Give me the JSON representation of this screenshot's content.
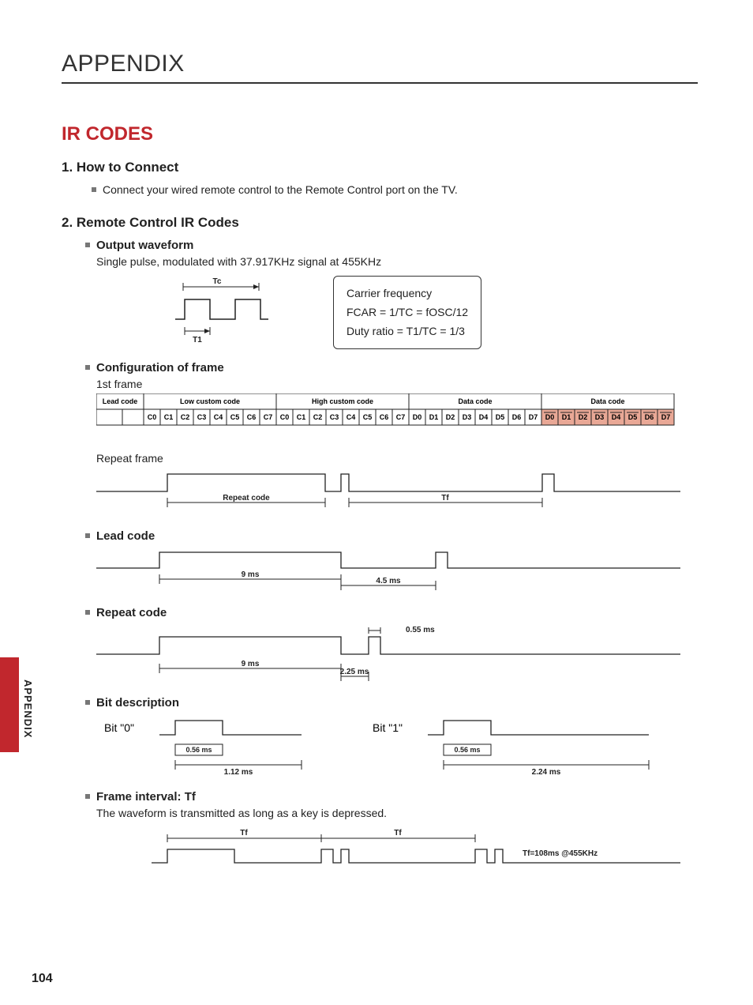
{
  "page_title": "APPENDIX",
  "section_title": "IR CODES",
  "s1": {
    "head": "1. How to Connect",
    "body": "Connect your wired remote control to the Remote Control port on the TV."
  },
  "s2": {
    "head": "2. Remote Control IR Codes",
    "output_waveform": {
      "label": "Output waveform",
      "desc": "Single pulse, modulated with 37.917KHz signal at 455KHz",
      "tc": "Tc",
      "t1": "T1",
      "box_line1": "Carrier frequency",
      "box_line2": "FCAR = 1/TC = fOSC/12",
      "box_line3": "Duty ratio = T1/TC = 1/3"
    },
    "config": {
      "label": "Configuration of frame",
      "first_frame": "1st frame",
      "groups": [
        "Lead code",
        "Low custom code",
        "High custom code",
        "Data code",
        "Data code"
      ],
      "c_bits": [
        "C0",
        "C1",
        "C2",
        "C3",
        "C4",
        "C5",
        "C6",
        "C7"
      ],
      "d_bits": [
        "D0",
        "D1",
        "D2",
        "D3",
        "D4",
        "D5",
        "D6",
        "D7"
      ],
      "repeat_frame": "Repeat frame",
      "repeat_code": "Repeat  code",
      "tf": "Tf"
    },
    "lead": {
      "label": "Lead code",
      "t1": "9 ms",
      "t2": "4.5 ms"
    },
    "repeat": {
      "label": "Repeat code",
      "t0": "0.55 ms",
      "t1": "9 ms",
      "t2": "2.25 ms"
    },
    "bits": {
      "label": "Bit description",
      "bit0": "Bit \"0\"",
      "bit1": "Bit \"1\"",
      "p": "0.56 ms",
      "w0": "1.12 ms",
      "w1": "2.24 ms"
    },
    "frame_int": {
      "label": "Frame interval: Tf",
      "desc": "The waveform is transmitted as long as a key is depressed.",
      "tf": "Tf",
      "note": "Tf=108ms @455KHz"
    }
  },
  "sidebar": "APPENDIX",
  "page_num": "104"
}
